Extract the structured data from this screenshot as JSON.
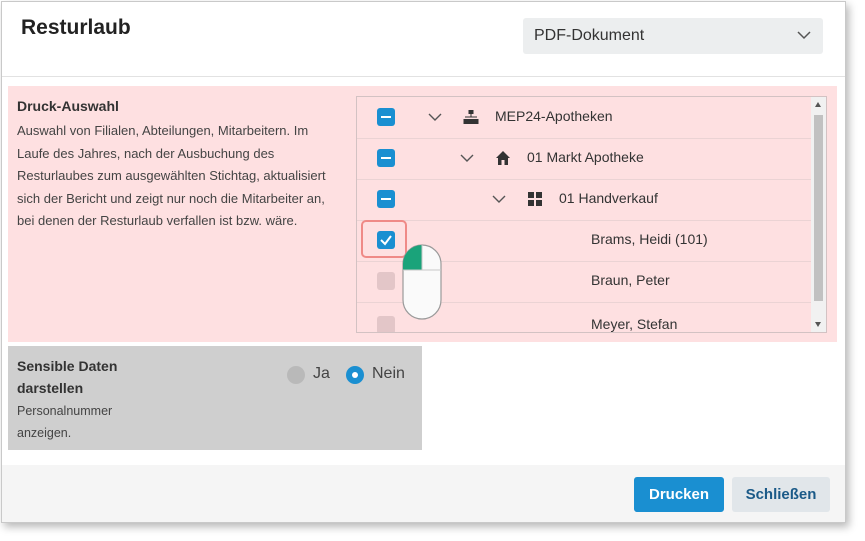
{
  "dialog": {
    "title": "Resturlaub",
    "format_select": {
      "value": "PDF-Dokument"
    }
  },
  "selection": {
    "title": "Druck-Auswahl",
    "description": "Auswahl von Filialen, Abteilungen, Mitarbeitern. Im Laufe des Jahres, nach der Ausbuchung des Resturlaubes zum ausgewählten Stichtag, aktualisiert sich der Bericht und zeigt nur noch die Mitarbeiter an, bei denen der Resturlaub verfallen ist bzw. wäre.",
    "tree": [
      {
        "label": "MEP24-Apotheken",
        "state": "indeterminate",
        "icon": "organization-icon",
        "expanded": true
      },
      {
        "label": "01 Markt Apotheke",
        "state": "indeterminate",
        "icon": "home-icon",
        "expanded": true
      },
      {
        "label": "01 Handverkauf",
        "state": "indeterminate",
        "icon": "grid-icon",
        "expanded": true
      },
      {
        "label": "Brams, Heidi (101)",
        "state": "checked"
      },
      {
        "label": "Braun, Peter",
        "state": "unchecked"
      },
      {
        "label": "Meyer, Stefan",
        "state": "unchecked"
      }
    ]
  },
  "sensitive": {
    "title": "Sensible Daten darstellen",
    "description": "Personalnummer anzeigen.",
    "options": [
      {
        "label": "Ja",
        "selected": false
      },
      {
        "label": "Nein",
        "selected": true
      }
    ]
  },
  "footer": {
    "print_label": "Drucken",
    "close_label": "Schließen"
  },
  "colors": {
    "accent": "#1a8fd1",
    "selection_bg": "#fee0e1",
    "sensitive_bg": "#cfcfcf"
  }
}
